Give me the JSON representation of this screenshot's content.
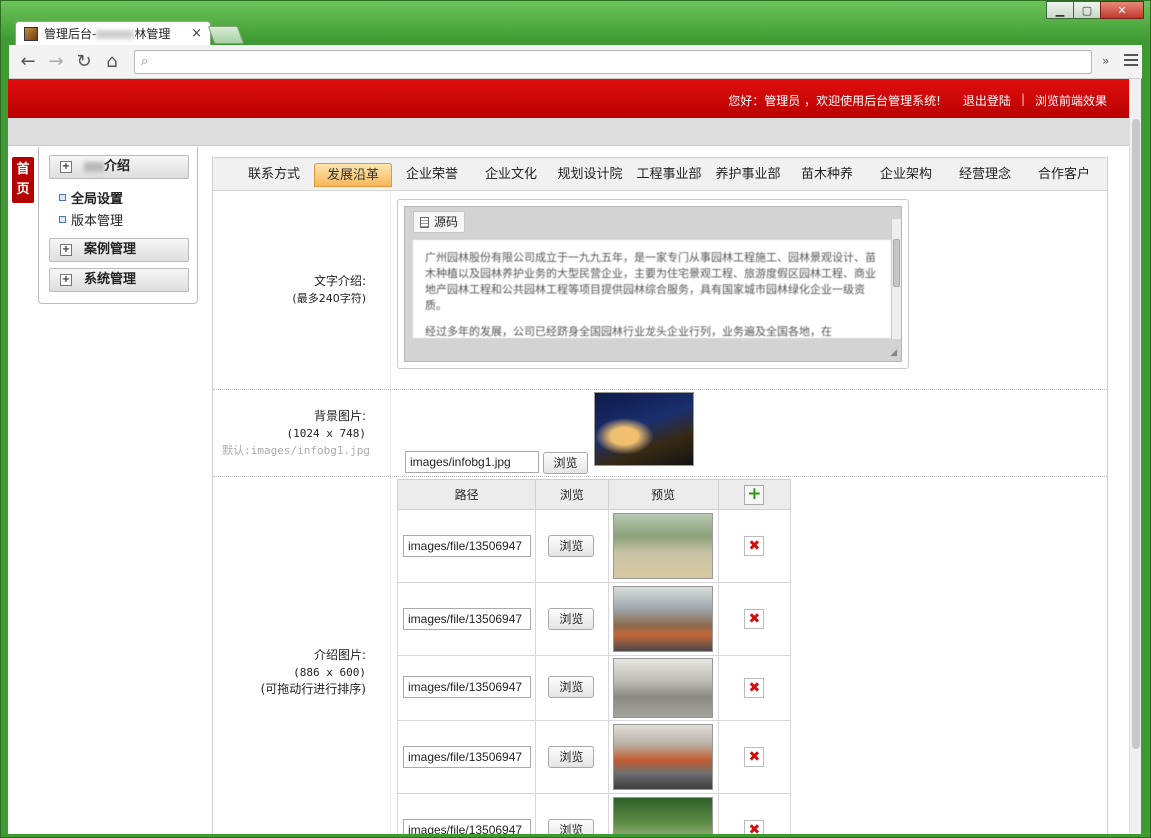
{
  "browser": {
    "tab_title": "管理后台-",
    "tab_title_suffix": "林管理",
    "tab_close": "×",
    "back_icon": "←",
    "forward_icon": "→",
    "reload_icon": "↻",
    "home_icon": "⌂",
    "search_icon": "⌕",
    "overflow": "»",
    "win_min": "▁",
    "win_max": "▢",
    "win_close": "✕"
  },
  "header": {
    "greeting": "您好：管理员 ，欢迎使用后台管理系统!",
    "logout": "退出登陆",
    "separator": "|",
    "view_frontend": "浏览前端效果"
  },
  "home_tab": "首页",
  "sidebar": {
    "section1_label": "介绍",
    "section1_items": [
      "全局设置",
      "版本管理"
    ],
    "section2_label": "案例管理",
    "section3_label": "系统管理",
    "plus": "+"
  },
  "tabs": [
    "联系方式",
    "发展沿革",
    "企业荣誉",
    "企业文化",
    "规划设计院",
    "工程事业部",
    "养护事业部",
    "苗木种养",
    "企业架构",
    "经营理念",
    "合作客户"
  ],
  "active_tab": "发展沿革",
  "text_intro": {
    "label": "文字介绍:",
    "hint": "(最多240字符)",
    "source_button": "源码",
    "paragraph1": "广州园林股份有限公司成立于一九九五年，是一家专门从事园林工程施工、园林景观设计、苗木种植以及园林养护业务的大型民营企业，主要为住宅景观工程、旅游度假区园林工程、商业地产园林工程和公共园林工程等项目提供园林综合服务，具有国家城市园林绿化企业一级资质。",
    "paragraph2": "经过多年的发展，公司已经跻身全国园林行业龙头企业行列，业务遍及全国各地，在"
  },
  "background": {
    "label": "背景图片:",
    "size": "(1024 x 748)",
    "default_hint": "默认:images/infobg1.jpg",
    "value": "images/infobg1.jpg",
    "browse": "浏览"
  },
  "intro_images": {
    "label": "介绍图片:",
    "size": "(886 x 600)",
    "hint": "(可拖动行进行排序)",
    "columns": [
      "路径",
      "浏览",
      "预览"
    ],
    "add_icon": "+",
    "rows": [
      {
        "path": "images/file/13506947",
        "browse": "浏览",
        "delete": "✖"
      },
      {
        "path": "images/file/13506947",
        "browse": "浏览",
        "delete": "✖"
      },
      {
        "path": "images/file/13506947",
        "browse": "浏览",
        "delete": "✖"
      },
      {
        "path": "images/file/13506947",
        "browse": "浏览",
        "delete": "✖"
      },
      {
        "path": "images/file/13506947",
        "browse": "浏览",
        "delete": "✖"
      }
    ]
  }
}
